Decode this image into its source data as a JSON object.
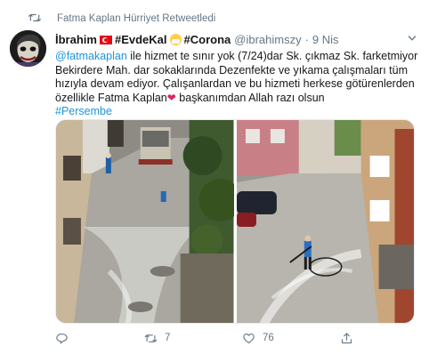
{
  "retweet": {
    "text": "Fatma Kaplan Hürriyet Retweetledi",
    "icon": "retweet-icon"
  },
  "author": {
    "name": "İbrahim",
    "flag_icon": "turkey-flag-icon",
    "tag1": "#EvdeKal",
    "mask_icon": "face-with-medical-mask-icon",
    "tag2": "#Corona",
    "handle": "@ibrahimszy",
    "dot": "·",
    "date": "9 Nis"
  },
  "tweet": {
    "mention": "@fatmakaplan",
    "text1": " ile hizmet te sınır yok (7/24)dar Sk. çıkmaz Sk. farketmiyor Bekirdere Mah. dar sokaklarında Dezenfekte ve yıkama çalışmaları tüm hızıyla devam ediyor. Çalışanlardan ve bu hizmeti herkese götürenlerden özellikle Fatma Kaplan",
    "heart_icon": "red-heart-icon",
    "text2": " başkanımdan Allah razı olsun",
    "hashtag": "#Persembe"
  },
  "actions": {
    "reply_icon": "reply-icon",
    "retweet_icon": "retweet-icon",
    "retweet_count": "7",
    "like_icon": "heart-icon",
    "like_count": "76",
    "share_icon": "share-icon"
  },
  "colors": {
    "link": "#1b95e0",
    "muted": "#657786",
    "heart": "#e0245e"
  }
}
